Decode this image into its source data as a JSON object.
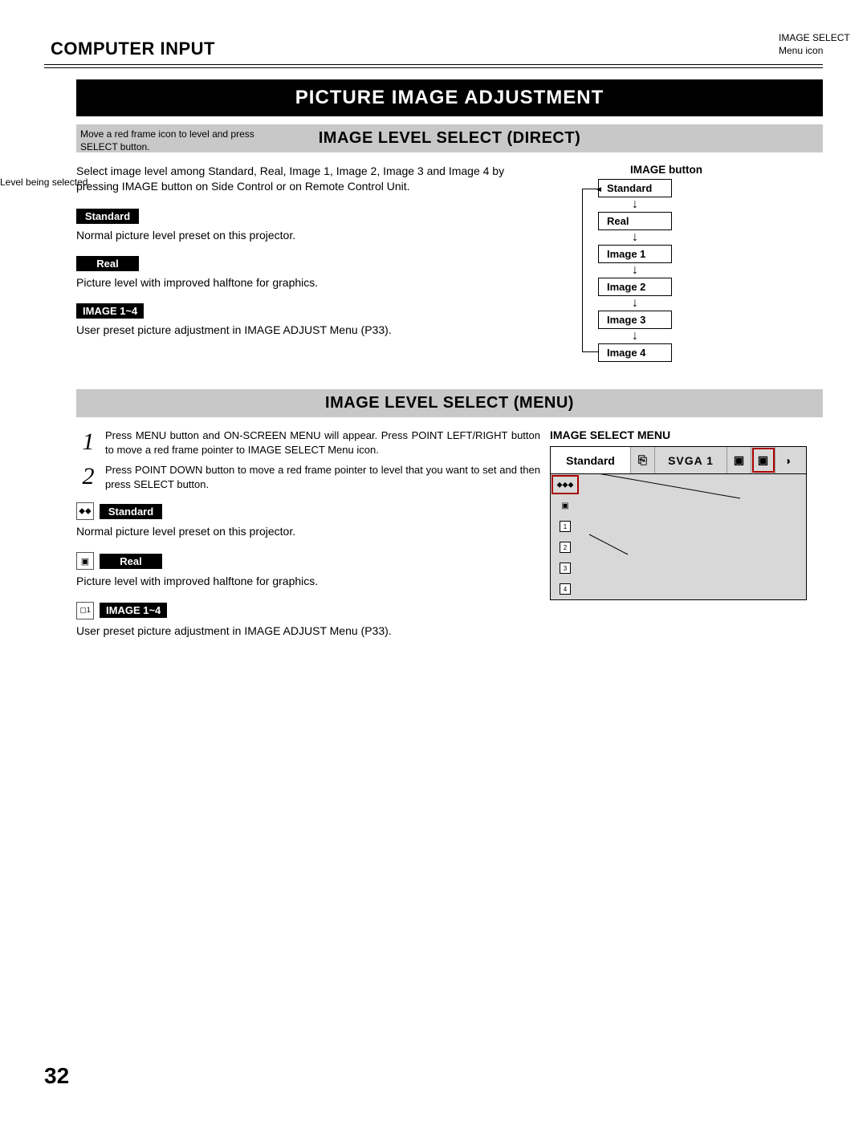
{
  "chapter": "COMPUTER INPUT",
  "title": "PICTURE IMAGE ADJUSTMENT",
  "section_direct": {
    "heading": "IMAGE LEVEL SELECT (DIRECT)",
    "intro": "Select image level among Standard, Real, Image 1, Image 2, Image 3 and Image 4 by pressing IMAGE button on Side Control or on Remote Control Unit.",
    "items": [
      {
        "label": "Standard",
        "desc": "Normal picture level preset on this projector."
      },
      {
        "label": "Real",
        "desc": "Picture level with improved halftone for graphics."
      },
      {
        "label": "IMAGE 1~4",
        "desc": "User preset picture adjustment in IMAGE ADJUST Menu (P33)."
      }
    ],
    "flow_title": "IMAGE button",
    "flow": [
      "Standard",
      "Real",
      "Image 1",
      "Image 2",
      "Image 3",
      "Image 4"
    ]
  },
  "section_menu": {
    "heading": "IMAGE LEVEL SELECT (MENU)",
    "steps": [
      "Press MENU button and ON-SCREEN MENU will appear. Press POINT LEFT/RIGHT button to move a red frame pointer to IMAGE SELECT Menu icon.",
      "Press POINT DOWN button to move a red frame pointer to level that you want to set and then press SELECT button."
    ],
    "items": [
      {
        "label": "Standard",
        "desc": "Normal picture level preset on this projector."
      },
      {
        "label": "Real",
        "desc": "Picture level with improved halftone for graphics."
      },
      {
        "label": "IMAGE 1~4",
        "desc": "User preset picture adjustment in IMAGE ADJUST Menu (P33)."
      }
    ],
    "osd": {
      "title": "IMAGE SELECT MENU",
      "top_name": "Standard",
      "top_res": "SVGA 1",
      "side": [
        "⬥⬥⬥",
        "▣",
        "1",
        "2",
        "3",
        "4"
      ],
      "callout_icon": "IMAGE SELECT Menu icon",
      "callout_move": "Move a red frame icon to level and press SELECT button.",
      "callout_level": "Level being selected."
    }
  },
  "page_number": "32"
}
